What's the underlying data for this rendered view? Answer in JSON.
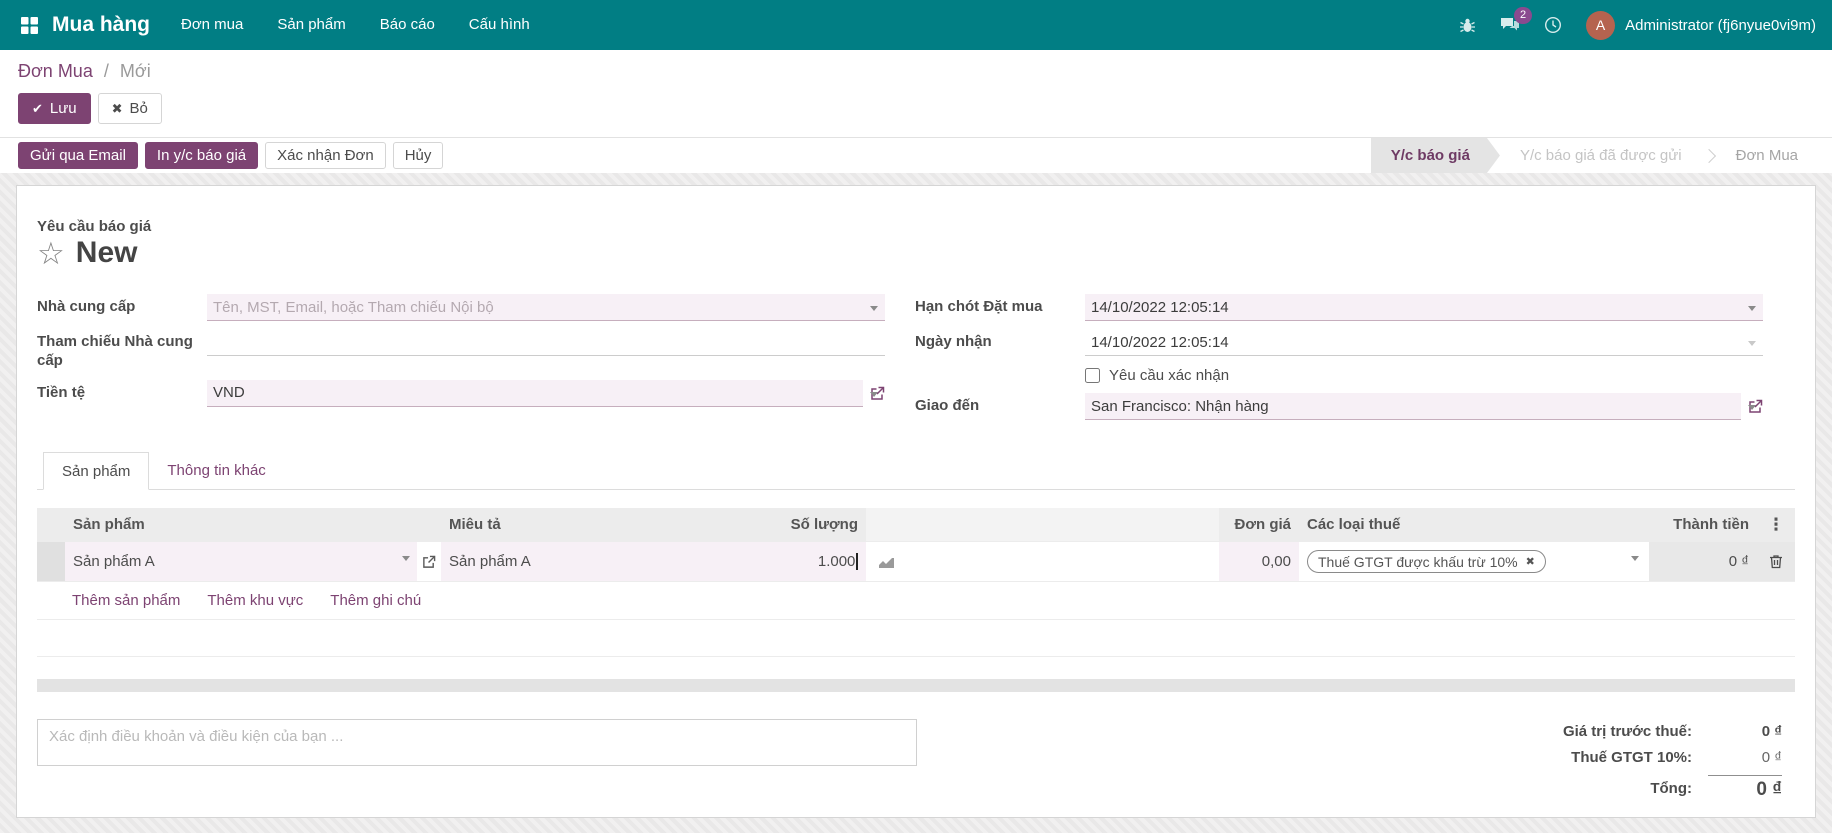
{
  "navbar": {
    "app_name": "Mua hàng",
    "menus": [
      "Đơn mua",
      "Sản phẩm",
      "Báo cáo",
      "Cấu hình"
    ],
    "message_badge": "2",
    "user_initial": "A",
    "user_name": "Administrator (fj6nyue0vi9m)"
  },
  "breadcrumb": {
    "parent": "Đơn Mua",
    "separator": "/",
    "current": "Mới"
  },
  "actions": {
    "save": "Lưu",
    "discard": "Bỏ"
  },
  "statusbar": {
    "buttons": [
      {
        "label": "Gửi qua Email",
        "style": "primary"
      },
      {
        "label": "In y/c báo giá",
        "style": "primary"
      },
      {
        "label": "Xác nhận Đơn",
        "style": "secondary"
      },
      {
        "label": "Hủy",
        "style": "secondary"
      }
    ],
    "states": [
      {
        "label": "Y/c báo giá",
        "active": true
      },
      {
        "label": "Y/c báo giá đã được gửi",
        "active": false
      },
      {
        "label": "Đơn Mua",
        "active": false
      }
    ]
  },
  "sheet": {
    "subtitle": "Yêu cầu báo giá",
    "title": "New",
    "fields": {
      "vendor": {
        "label": "Nhà cung cấp",
        "placeholder": "Tên, MST, Email, hoặc Tham chiếu Nội bộ",
        "value": ""
      },
      "vendor_reference": {
        "label": "Tham chiếu Nhà cung cấp",
        "value": ""
      },
      "currency": {
        "label": "Tiền tệ",
        "value": "VND"
      },
      "order_deadline": {
        "label": "Hạn chót Đặt mua",
        "value": "14/10/2022 12:05:14"
      },
      "receipt_date": {
        "label": "Ngày nhận",
        "value": "14/10/2022 12:05:14"
      },
      "confirmation": {
        "label": "Yêu cầu xác nhận",
        "checked": false
      },
      "deliver_to": {
        "label": "Giao đến",
        "value": "San Francisco: Nhận hàng"
      }
    },
    "tabs": [
      {
        "label": "Sản phẩm",
        "active": true
      },
      {
        "label": "Thông tin khác",
        "active": false
      }
    ],
    "lines": {
      "headers": [
        "Sản phẩm",
        "Miêu tả",
        "Số lượng",
        "Đơn giá",
        "Các loại thuế",
        "Thành tiền"
      ],
      "rows": [
        {
          "product": "Sản phẩm A",
          "description": "Sản phẩm A",
          "quantity": "1.000",
          "unit_price": "0,00",
          "tax": "Thuế GTGT được khấu trừ 10%",
          "subtotal": "0 ₫"
        }
      ],
      "add_links": [
        "Thêm sản phẩm",
        "Thêm khu vực",
        "Thêm ghi chú"
      ]
    },
    "notes_placeholder": "Xác định điều khoản và điều kiện của bạn ...",
    "totals": [
      {
        "label": "Giá trị trước thuế:",
        "value": "0 ₫"
      },
      {
        "label": "Thuế GTGT 10%:",
        "value": "0 ₫"
      },
      {
        "label": "Tổng:",
        "value": "0 ₫"
      }
    ]
  },
  "icons": {
    "star": "☆",
    "check": "✔",
    "close": "✖",
    "remove_tag": "✖",
    "optional_columns": "⋮"
  },
  "colors": {
    "navbar": "#017e84",
    "primary": "#7d4372",
    "field_highlight": "#f7f0f6",
    "badge": "#8a4a8f",
    "avatar": "#b5634f"
  }
}
